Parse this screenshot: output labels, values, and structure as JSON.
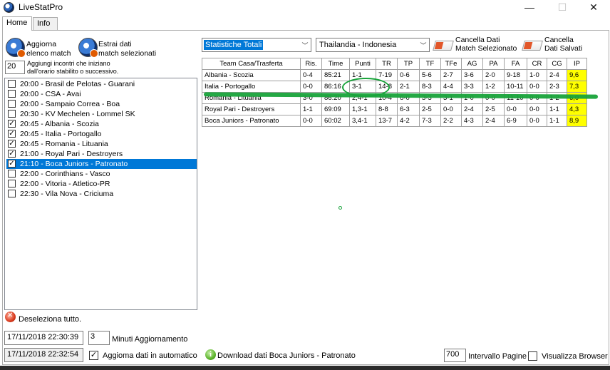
{
  "window": {
    "title": "LiveStatPro",
    "min": "—",
    "max": "☐",
    "close": "✕"
  },
  "tabs": [
    {
      "label": "Home"
    },
    {
      "label": "Info"
    }
  ],
  "left": {
    "refresh_button": {
      "line1": "Aggiorna",
      "line2": "elenco match"
    },
    "extract_button": {
      "line1": "Estrai dati",
      "line2": "match selezionati"
    },
    "add_minutes_value": "20",
    "add_note_line1": "Aggiungi incontri che iniziano",
    "add_note_line2": "dall'orario stabilito o successivo.",
    "matches": [
      {
        "label": "20:00 - Brasil de Pelotas - Guarani",
        "checked": false,
        "selected": false
      },
      {
        "label": "20:00 - CSA - Avai",
        "checked": false,
        "selected": false
      },
      {
        "label": "20:00 - Sampaio Correa - Boa",
        "checked": false,
        "selected": false
      },
      {
        "label": "20:30 - KV Mechelen - Lommel SK",
        "checked": false,
        "selected": false
      },
      {
        "label": "20:45 - Albania - Scozia",
        "checked": true,
        "selected": false
      },
      {
        "label": "20:45 - Italia - Portogallo",
        "checked": true,
        "selected": false
      },
      {
        "label": "20:45 - Romania - Lituania",
        "checked": true,
        "selected": false
      },
      {
        "label": "21:00 - Royal Pari - Destroyers",
        "checked": true,
        "selected": false
      },
      {
        "label": "21:10 - Boca Juniors - Patronato",
        "checked": true,
        "selected": true
      },
      {
        "label": "22:00 - Corinthians - Vasco",
        "checked": false,
        "selected": false
      },
      {
        "label": "22:00 - Vitoria - Atletico-PR",
        "checked": false,
        "selected": false
      },
      {
        "label": "22:30 - Vila Nova - Criciuma",
        "checked": false,
        "selected": false
      }
    ],
    "deselect_label": "Deseleziona tutto.",
    "datetime_1": "17/11/2018 22:30:39",
    "update_minutes_value": "3",
    "update_minutes_label": "Minuti Aggiornamento",
    "datetime_2": "17/11/2018 22:32:54",
    "auto_update_label": "Aggioma dati  in automatico",
    "auto_update_checked": true
  },
  "toolbar": {
    "stats_dropdown": "Statistiche Totali",
    "match_dropdown": "Thailandia - Indonesia",
    "clear_match": {
      "line1": "Cancella Dati",
      "line2": "Match Selezionato"
    },
    "clear_saved": {
      "line1": "Cancella",
      "line2": "Dati Salvati"
    }
  },
  "table": {
    "headers": [
      "Team Casa/Trasferta",
      "Ris.",
      "Time",
      "Punti",
      "TR",
      "TP",
      "TF",
      "TFe",
      "AG",
      "PA",
      "FA",
      "CR",
      "CG",
      "IP"
    ],
    "rows": [
      [
        "Albania - Scozia",
        "0-4",
        "85:21",
        "1-1",
        "7-19",
        "0-6",
        "5-6",
        "2-7",
        "3-6",
        "2-0",
        "9-18",
        "1-0",
        "2-4",
        "9,6"
      ],
      [
        "Italia - Portogallo",
        "0-0",
        "86:16",
        "3-1",
        "14-8",
        "2-1",
        "8-3",
        "4-4",
        "3-3",
        "1-2",
        "10-11",
        "0-0",
        "2-3",
        "7,3"
      ],
      [
        "Romania - Lituania",
        "3-0",
        "86:20",
        "2,4-1",
        "10-4",
        "6-0",
        "3-3",
        "3-1",
        "1-0",
        "0-0",
        "11-10",
        "0-0",
        "1-2",
        "6,0"
      ],
      [
        "Royal Pari - Destroyers",
        "1-1",
        "69:09",
        "1,3-1",
        "8-8",
        "6-3",
        "2-5",
        "0-0",
        "2-4",
        "2-5",
        "0-0",
        "0-0",
        "1-1",
        "4,3"
      ],
      [
        "Boca Juniors - Patronato",
        "0-0",
        "60:02",
        "3,4-1",
        "13-7",
        "4-2",
        "7-3",
        "2-2",
        "4-3",
        "2-4",
        "6-9",
        "0-0",
        "1-1",
        "8,9"
      ]
    ],
    "ip_color": "#ffff00"
  },
  "footer": {
    "download_label": "Download dati Boca Juniors - Patronato",
    "interval_value": "700",
    "interval_label": "Intervallo Pagine",
    "browser_label": "Visualizza Browser",
    "browser_checked": false
  },
  "colors": {
    "selection": "#0078d7",
    "annotation": "#18a33a",
    "ip_highlight": "#ffff00"
  }
}
